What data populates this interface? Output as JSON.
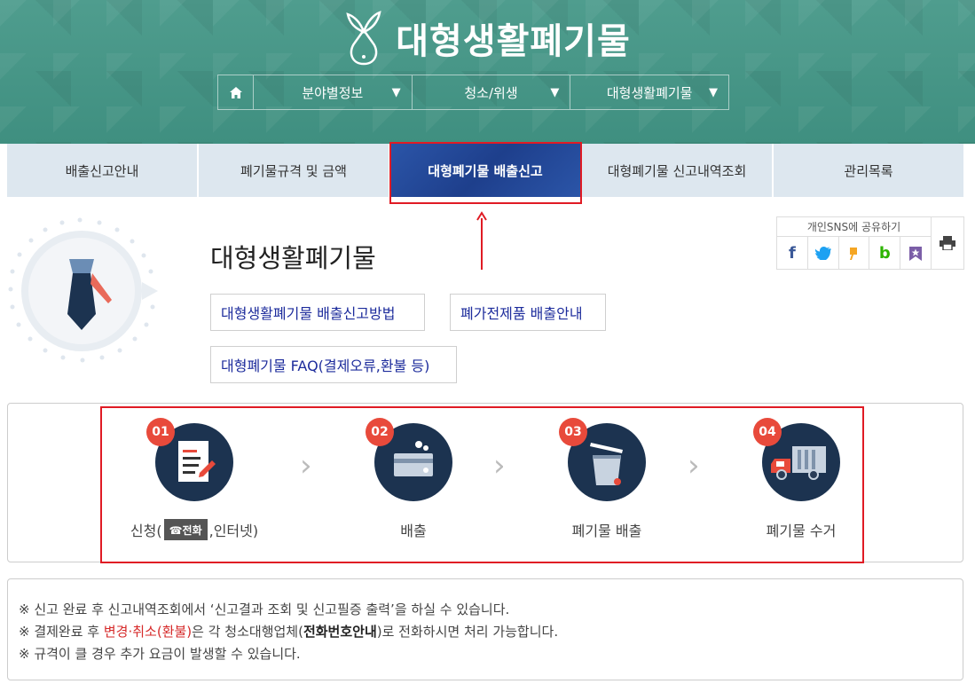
{
  "header": {
    "site_title": "대형생활폐기물",
    "nav": {
      "home_icon": "home-icon",
      "items": [
        {
          "label": "분야별정보",
          "arrow": "▼"
        },
        {
          "label": "청소/위생",
          "arrow": "▼"
        },
        {
          "label": "대형생활폐기물",
          "arrow": "▼"
        }
      ]
    }
  },
  "tabs": [
    {
      "label": "배출신고안내",
      "active": false
    },
    {
      "label": "폐기물규격 및 금액",
      "active": false
    },
    {
      "label": "대형폐기물 배출신고",
      "active": true
    },
    {
      "label": "대형폐기물 신고내역조회",
      "active": false
    },
    {
      "label": "관리목록",
      "active": false
    }
  ],
  "intro": {
    "title": "대형생활폐기물",
    "links": [
      "대형생활폐기물 배출신고방법",
      "폐가전제품 배출안내",
      "대형폐기물 FAQ(결제오류,환불 등)"
    ]
  },
  "sns": {
    "label": "개인SNS에 공유하기",
    "icons": [
      "facebook-icon",
      "twitter-icon",
      "kakaostory-icon",
      "band-icon",
      "bookmark-icon"
    ],
    "print_icon": "print-icon"
  },
  "steps": [
    {
      "num": "01",
      "label_prefix": "신청(",
      "phone_chip": "☎전화",
      "label_suffix": ",인터넷)",
      "icon": "document-pen-icon"
    },
    {
      "num": "02",
      "label": "배출",
      "icon": "payment-card-icon"
    },
    {
      "num": "03",
      "label": "폐기물 배출",
      "icon": "trash-bin-icon"
    },
    {
      "num": "04",
      "label": "폐기물 수거",
      "icon": "garbage-truck-icon"
    }
  ],
  "notes": {
    "line1": "※ 신고 완료 후 신고내역조회에서 ‘신고결과 조회 및 신고필증 출력’을 하실 수 있습니다.",
    "line2_a": "※ 결제완료 후 ",
    "line2_red": "변경·취소(환불)",
    "line2_b": "은 각 청소대행업체(",
    "line2_bold": "전화번호안내",
    "line2_c": ")로 전화하시면 처리 가능합니다.",
    "line3": "※ 규격이 클 경우 추가 요금이 발생할 수 있습니다."
  },
  "colors": {
    "header_teal": "#469585",
    "active_tab": "#2447a0",
    "step_circle": "#1c3350",
    "step_badge": "#e84a3b",
    "highlight_red": "#e01b24"
  }
}
